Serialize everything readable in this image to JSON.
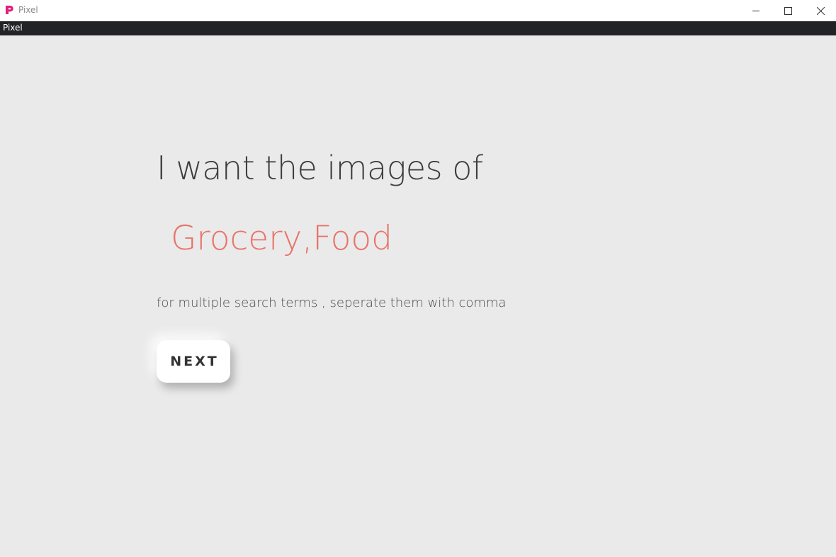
{
  "window": {
    "title": "Pixel",
    "brand_color": "#e0207a",
    "icons": {
      "logo": "pixel-logo-icon",
      "minimize": "minimize-icon",
      "maximize": "maximize-icon",
      "close": "close-icon"
    }
  },
  "menubar": {
    "title": "Pixel"
  },
  "main": {
    "heading": "I want the images of",
    "search": {
      "value": "Grocery,Food",
      "color": "#e8746a"
    },
    "hint": "for multiple search terms , seperate them with comma",
    "next_label": "NEXT"
  }
}
